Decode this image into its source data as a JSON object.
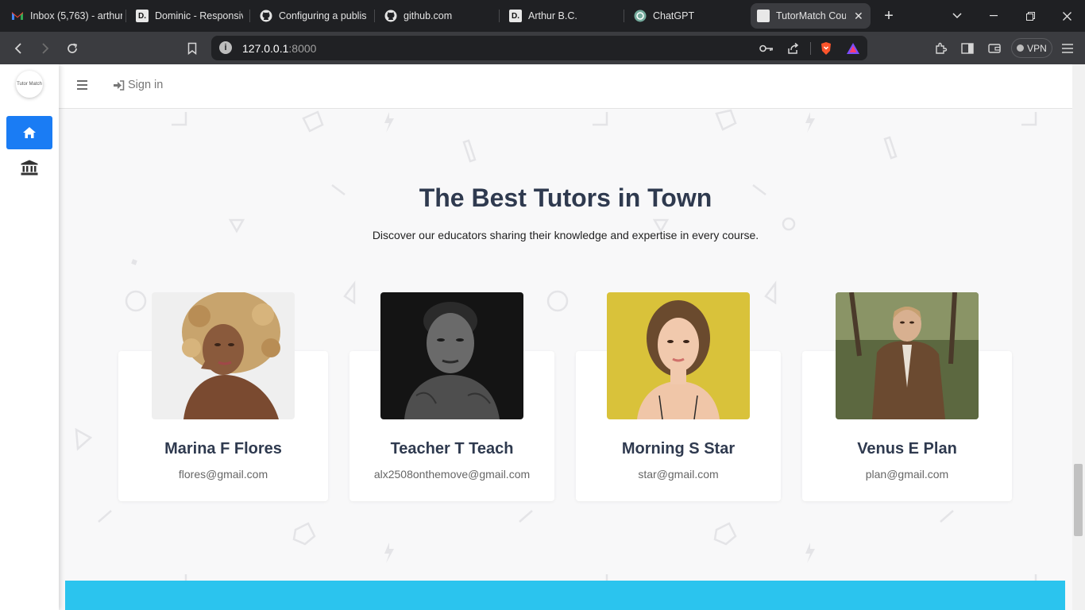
{
  "browser": {
    "tabs": [
      {
        "title": "Inbox (5,763) - arthur",
        "icon": "gmail-icon"
      },
      {
        "title": "Dominic - Responsive",
        "icon": "d-letter-icon"
      },
      {
        "title": "Configuring a publish",
        "icon": "github-icon"
      },
      {
        "title": "github.com",
        "icon": "github-icon"
      },
      {
        "title": "Arthur B.C.",
        "icon": "d-letter-icon"
      },
      {
        "title": "ChatGPT",
        "icon": "chatgpt-icon"
      },
      {
        "title": "TutorMatch Cou",
        "icon": "page-icon",
        "active": true
      }
    ],
    "url_host": "127.0.0.1",
    "url_port": ":8000",
    "vpn_label": "VPN",
    "new_tab_glyph": "+",
    "close_glyph": "✕"
  },
  "sidebar": {
    "logo_text": "Tutor Match",
    "items": [
      {
        "icon": "home-icon",
        "active": true
      },
      {
        "icon": "institution-icon",
        "active": false
      }
    ]
  },
  "topnav": {
    "signin_label": "Sign in"
  },
  "section": {
    "title": "The Best Tutors in Town",
    "subtitle": "Discover our educators sharing their knowledge and expertise in every course."
  },
  "tutors": [
    {
      "name": "Marina F Flores",
      "email": "flores@gmail.com",
      "photo": "woman-curly-blonde-hair-photo"
    },
    {
      "name": "Teacher T Teach",
      "email": "alx2508onthemove@gmail.com",
      "photo": "man-black-and-white-portrait-photo"
    },
    {
      "name": "Morning S Star",
      "email": "star@gmail.com",
      "photo": "woman-yellow-background-photo"
    },
    {
      "name": "Venus E Plan",
      "email": "plan@gmail.com",
      "photo": "woman-brown-jacket-outdoors-photo"
    }
  ],
  "colors": {
    "accent": "#1a7cf4",
    "heading": "#2f3a4f",
    "band": "#2bc4ee",
    "page_bg": "#f8f8f9"
  }
}
